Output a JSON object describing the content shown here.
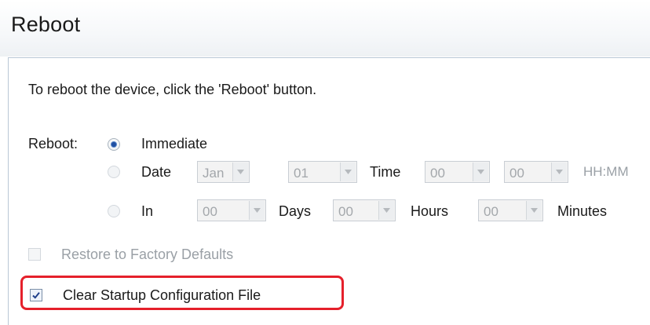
{
  "header": {
    "title": "Reboot"
  },
  "panel": {
    "instruction": "To reboot the device, click the 'Reboot' button.",
    "reboot_label": "Reboot:",
    "options": {
      "immediate": "Immediate",
      "date": "Date",
      "in": "In"
    },
    "date_row": {
      "month": "Jan",
      "day": "01",
      "time_label": "Time",
      "hour": "00",
      "minute": "00",
      "format_hint": "HH:MM"
    },
    "in_row": {
      "days_value": "00",
      "days_label": "Days",
      "hours_value": "00",
      "hours_label": "Hours",
      "minutes_value": "00",
      "minutes_label": "Minutes"
    },
    "restore_factory_label": "Restore to Factory Defaults",
    "clear_startup_label": "Clear Startup Configuration File"
  },
  "colors": {
    "highlight": "#e5202b",
    "radio_selected": "#1f4fa3"
  }
}
